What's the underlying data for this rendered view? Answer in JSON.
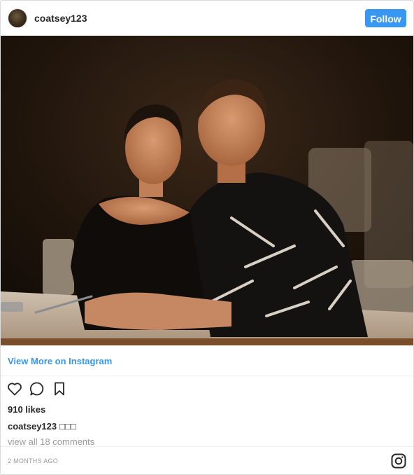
{
  "header": {
    "username": "coatsey123",
    "follow_label": "Follow",
    "avatar": "profile-avatar"
  },
  "photo": {
    "icon": "photograph"
  },
  "view_more": {
    "label": "View More on Instagram"
  },
  "actions": {
    "like_icon": "heart-icon",
    "comment_icon": "comment-icon",
    "save_icon": "bookmark-icon"
  },
  "likes": {
    "text": "910 likes"
  },
  "caption": {
    "username": "coatsey123",
    "text": "□□□"
  },
  "comments": {
    "text": "view all 18 comments"
  },
  "footer": {
    "timestamp": "2 MONTHS AGO",
    "logo_icon": "instagram-icon"
  },
  "colors": {
    "accent": "#3897f0",
    "text": "#262626",
    "muted": "#999999",
    "divider": "#efefef"
  }
}
